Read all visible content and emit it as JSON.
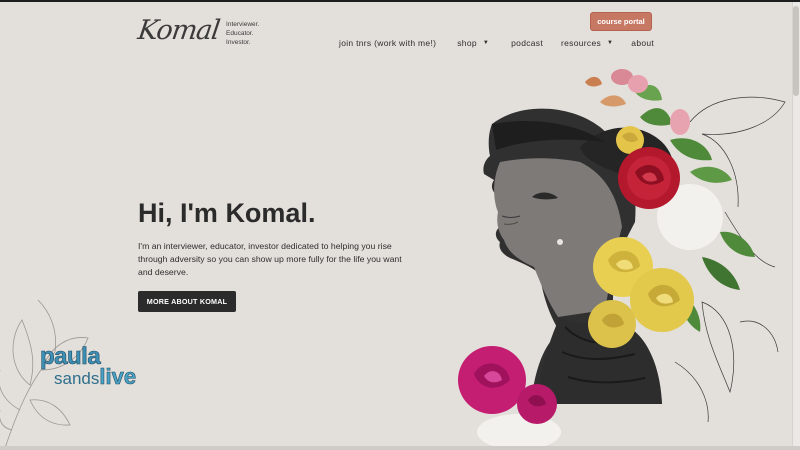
{
  "logo": {
    "script": "Komal",
    "tagline": [
      "Interviewer.",
      "Educator.",
      "Investor."
    ]
  },
  "header": {
    "course_portal_label": "course portal"
  },
  "nav": {
    "items": [
      {
        "label": "join tnrs (work with me!)",
        "has_dropdown": false
      },
      {
        "label": "shop",
        "has_dropdown": true
      },
      {
        "label": "podcast",
        "has_dropdown": false
      },
      {
        "label": "resources",
        "has_dropdown": true
      },
      {
        "label": "about",
        "has_dropdown": false
      }
    ]
  },
  "hero": {
    "greeting": "Hi, I'm ",
    "name": "Komal.",
    "description": "I'm an interviewer, educator, investor dedicated to helping you rise through adversity so you can show up more fully for the life you want and deserve.",
    "cta_label": "MORE ABOUT KOMAL"
  },
  "watermark": {
    "line1": "paula",
    "line2a": "sands",
    "line2b": "live"
  },
  "colors": {
    "background": "#e3dfdb",
    "portal_button": "#c77863",
    "cta_button": "#2b2b2b",
    "rose_red": "#b3182d",
    "rose_magenta": "#c41e73",
    "rose_yellow": "#e8cf52",
    "leaf_green": "#4e8a3a"
  }
}
